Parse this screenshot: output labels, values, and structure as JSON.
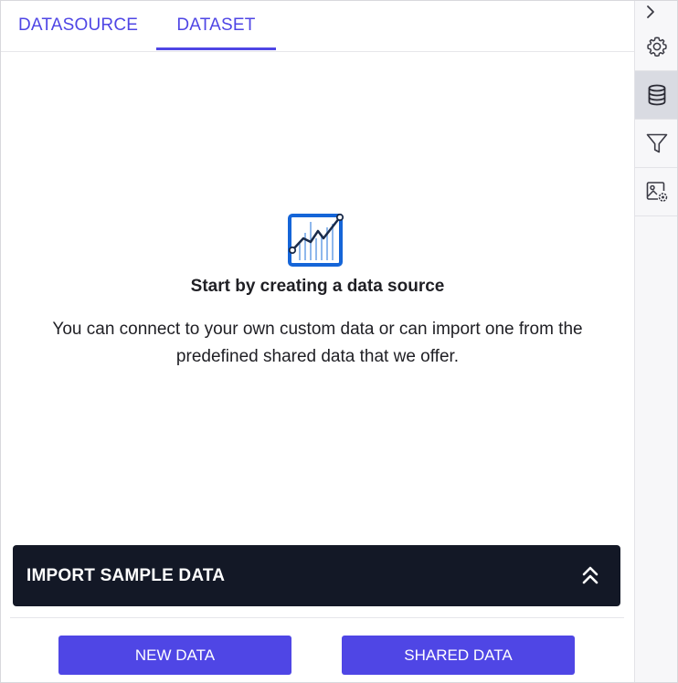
{
  "tabs": [
    {
      "label": "DATASOURCE",
      "active": false
    },
    {
      "label": "DATASET",
      "active": true
    }
  ],
  "empty_state": {
    "icon": "line-chart-icon",
    "title": "Start by creating a data source",
    "description": "You can connect to your own custom data or can import one from the predefined shared data that we offer."
  },
  "import_panel": {
    "label": "IMPORT SAMPLE DATA",
    "icon": "chevron-double-up-icon"
  },
  "actions": {
    "new_data": "NEW DATA",
    "shared_data": "SHARED DATA"
  },
  "rail": {
    "collapse_icon": "chevron-right-icon",
    "items": [
      {
        "icon": "gear-icon",
        "active": false
      },
      {
        "icon": "database-icon",
        "active": true
      },
      {
        "icon": "filter-icon",
        "active": false
      },
      {
        "icon": "image-settings-icon",
        "active": false
      }
    ]
  },
  "colors": {
    "accent": "#4f46e5",
    "dark_bar": "#131826",
    "text": "#1f1f24",
    "icon_blue": "#1565d8",
    "rail_bg": "#f7f7f9",
    "rail_active": "#d9dbe2"
  }
}
